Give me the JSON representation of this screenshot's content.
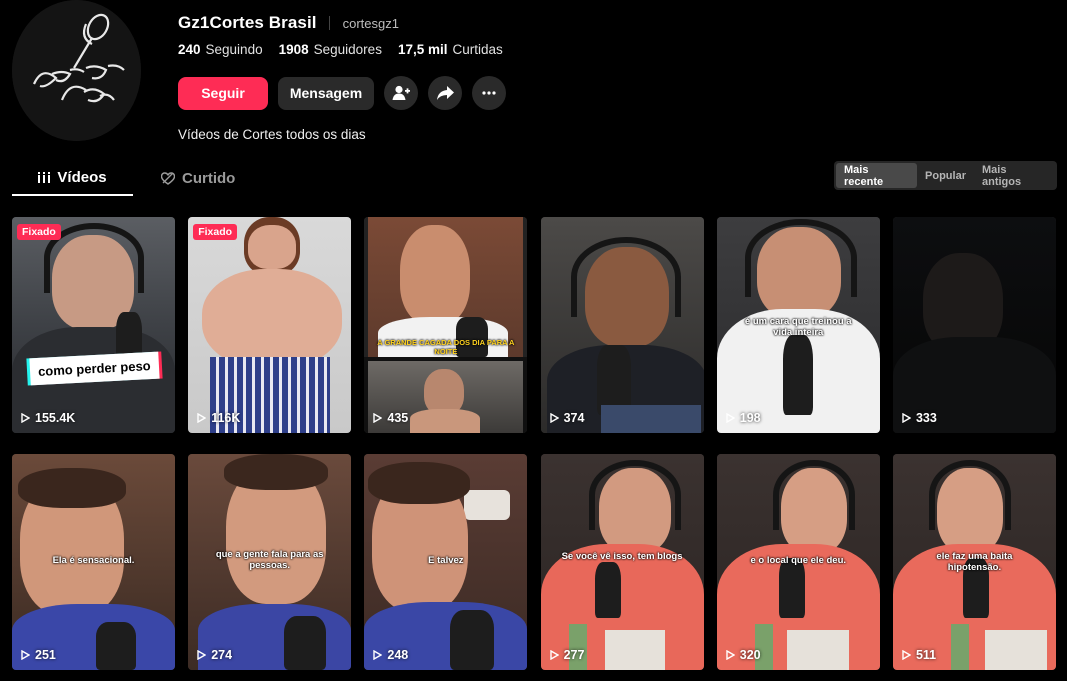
{
  "profile": {
    "display_name": "Gz1Cortes Brasil",
    "username": "cortesgz1",
    "following_count": "240",
    "following_label": "Seguindo",
    "followers_count": "1908",
    "followers_label": "Seguidores",
    "likes_count": "17,5 mil",
    "likes_label": "Curtidas",
    "bio": "Vídeos de Cortes todos os dias"
  },
  "actions": {
    "follow_label": "Seguir",
    "message_label": "Mensagem"
  },
  "tabs": [
    {
      "label": "Vídeos"
    },
    {
      "label": "Curtido"
    }
  ],
  "sort_options": [
    {
      "label": "Mais recente"
    },
    {
      "label": "Popular"
    },
    {
      "label": "Mais antigos"
    }
  ],
  "colors": {
    "accent": "#fe2c55",
    "background": "#000000",
    "button_dark": "#2a2a2a"
  },
  "videos": [
    {
      "views": "155.4K",
      "pinned": "Fixado",
      "caption": "como perder peso"
    },
    {
      "views": "116K",
      "pinned": "Fixado",
      "caption": ""
    },
    {
      "views": "435",
      "caption": "A GRANDE CAGADA DOS DIA PARA A NOITE"
    },
    {
      "views": "374",
      "caption": ""
    },
    {
      "views": "198",
      "caption": "é um cara que treinou a vida inteira"
    },
    {
      "views": "333",
      "caption": ""
    },
    {
      "views": "251",
      "caption": "Ela é sensacional."
    },
    {
      "views": "274",
      "caption": "que a gente fala para as pessoas."
    },
    {
      "views": "248",
      "caption": "E talvez"
    },
    {
      "views": "277",
      "caption": "Se você vê isso, tem blogs"
    },
    {
      "views": "320",
      "caption": "e o local que ele deu."
    },
    {
      "views": "511",
      "caption": "ele faz uma baita hipotensão."
    }
  ]
}
